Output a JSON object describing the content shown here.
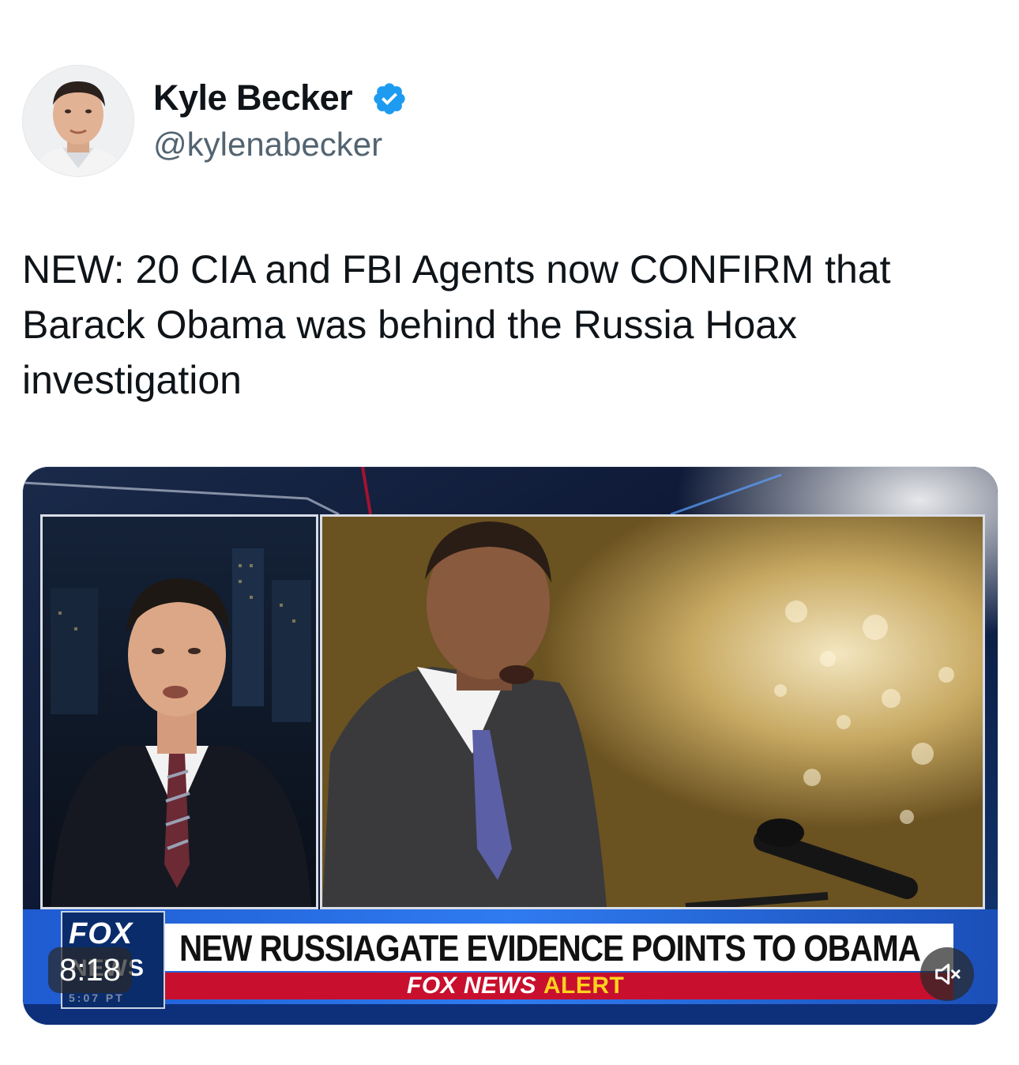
{
  "author": {
    "display_name": "Kyle Becker",
    "handle": "@kylenabecker",
    "verified": true,
    "avatar_icon": "profile-photo"
  },
  "tweet": {
    "text": "NEW: 20 CIA and FBI Agents now CONFIRM that\nBarack Obama was behind the Russia Hoax\ninvestigation"
  },
  "video": {
    "timestamp": "8:18",
    "muted": true,
    "mute_icon": "speaker-muted-icon",
    "chyron": {
      "headline": "NEW RUSSIAGATE EVIDENCE POINTS TO OBAMA",
      "alert_prefix": "FOX NEWS",
      "alert_word": "ALERT",
      "logo_top": "FOX",
      "logo_bottom": "NEWS",
      "logo_tz": "5:07 PT"
    }
  },
  "colors": {
    "verified_blue": "#1d9bf0",
    "fox_red": "#c8102e",
    "fox_navy": "#0a2c6b",
    "alert_yellow": "#ffd21f"
  }
}
